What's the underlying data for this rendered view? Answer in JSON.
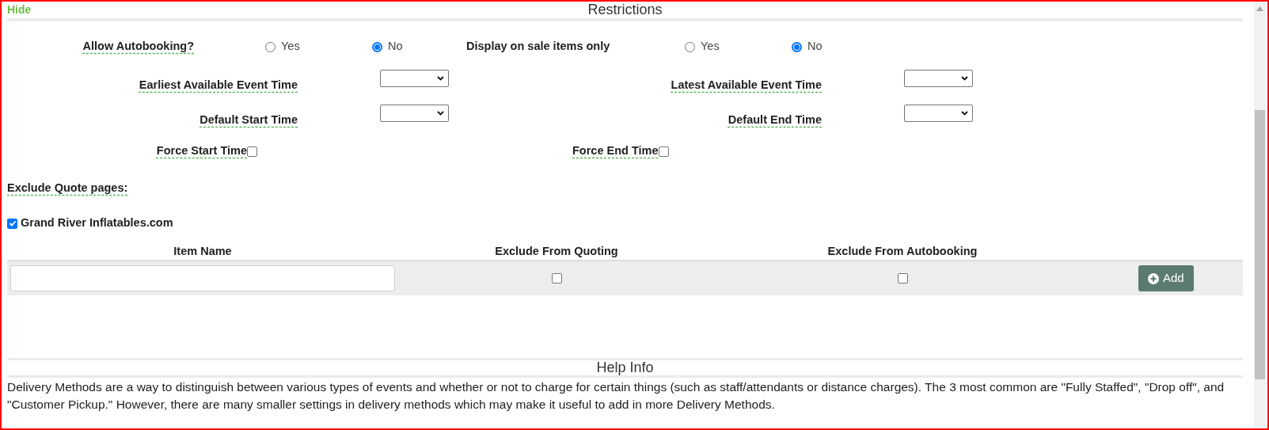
{
  "hide_link": "Hide",
  "section_title": "Restrictions",
  "radio_groups": [
    {
      "label": "Allow Autobooking?",
      "options": [
        {
          "label": "Yes",
          "selected": false
        },
        {
          "label": "No",
          "selected": true
        }
      ]
    },
    {
      "label": "Display on sale items only",
      "options": [
        {
          "label": "Yes",
          "selected": false
        },
        {
          "label": "No",
          "selected": true
        }
      ]
    }
  ],
  "time_rows": [
    [
      {
        "label": "Earliest Available Event Time"
      },
      {
        "label": "Latest Available Event Time"
      }
    ],
    [
      {
        "label": "Default Start Time"
      },
      {
        "label": "Default End Time"
      }
    ]
  ],
  "force_options": [
    {
      "label": "Force Start Time",
      "checked": false
    },
    {
      "label": "Force End Time",
      "checked": false
    }
  ],
  "exclude_quote_pages": {
    "label": "Exclude Quote pages:",
    "sites": [
      {
        "label": "Grand River Inflatables.com",
        "checked": true
      }
    ]
  },
  "item_table": {
    "columns": [
      "Item Name",
      "Exclude From Quoting",
      "Exclude From Autobooking"
    ],
    "new_row": {
      "exclude_from_quoting": false,
      "exclude_from_autobooking": false
    },
    "add_button": "Add"
  },
  "help": {
    "title": "Help Info",
    "text": "Delivery Methods are a way to distinguish between various types of events and whether or not to charge for certain things (such as staff/attendants or distance charges). The 3 most common are \"Fully Staffed\", \"Drop off\", and \"Customer Pickup.\" However, there are many smaller settings in delivery methods which may make it useful to add in more Delivery Methods."
  }
}
